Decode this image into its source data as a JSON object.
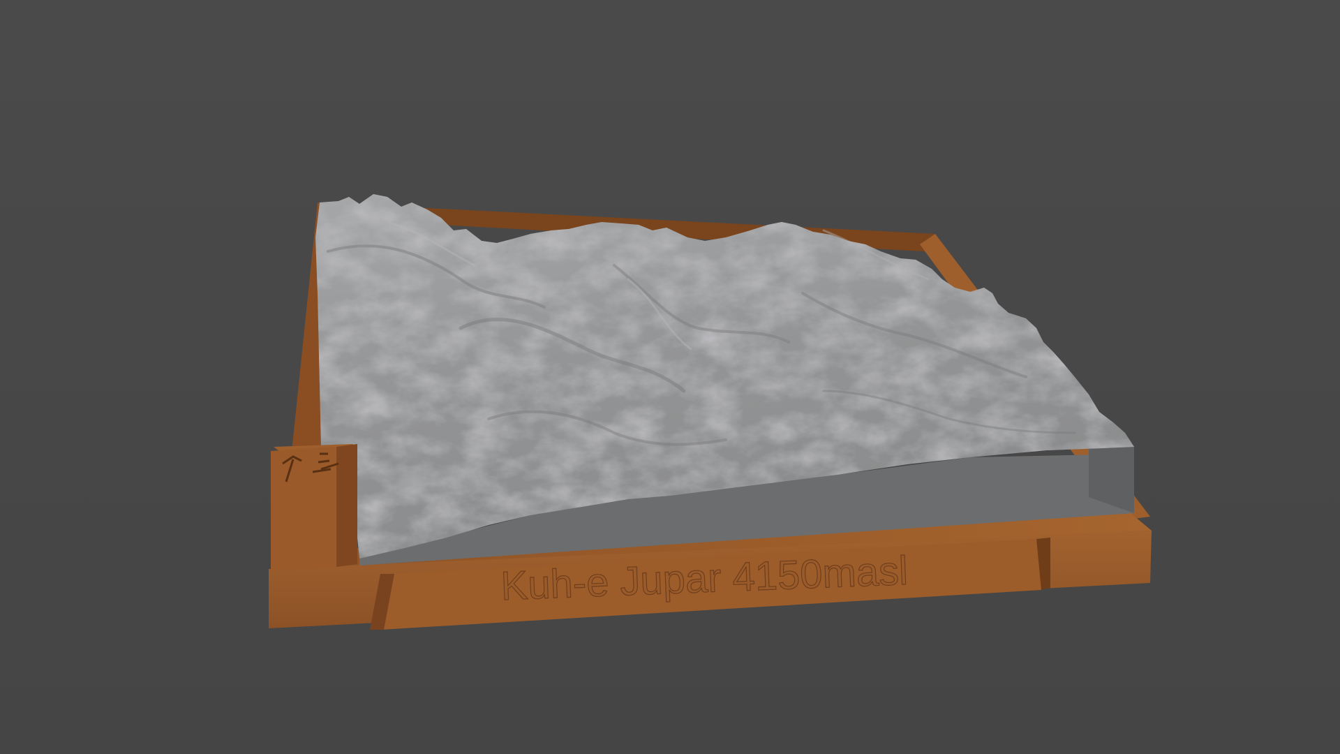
{
  "viewport": {
    "background_color": "#484848"
  },
  "model": {
    "base_color": "#9a5a2a",
    "base_shadow_color": "#6e3d1b",
    "terrain_color": "#8f9193",
    "terrain_side_color": "#6a6b6c",
    "plaque_text": "Kuh-e Jupar 4150masl",
    "compass_icon": "north-arrow-icon"
  }
}
